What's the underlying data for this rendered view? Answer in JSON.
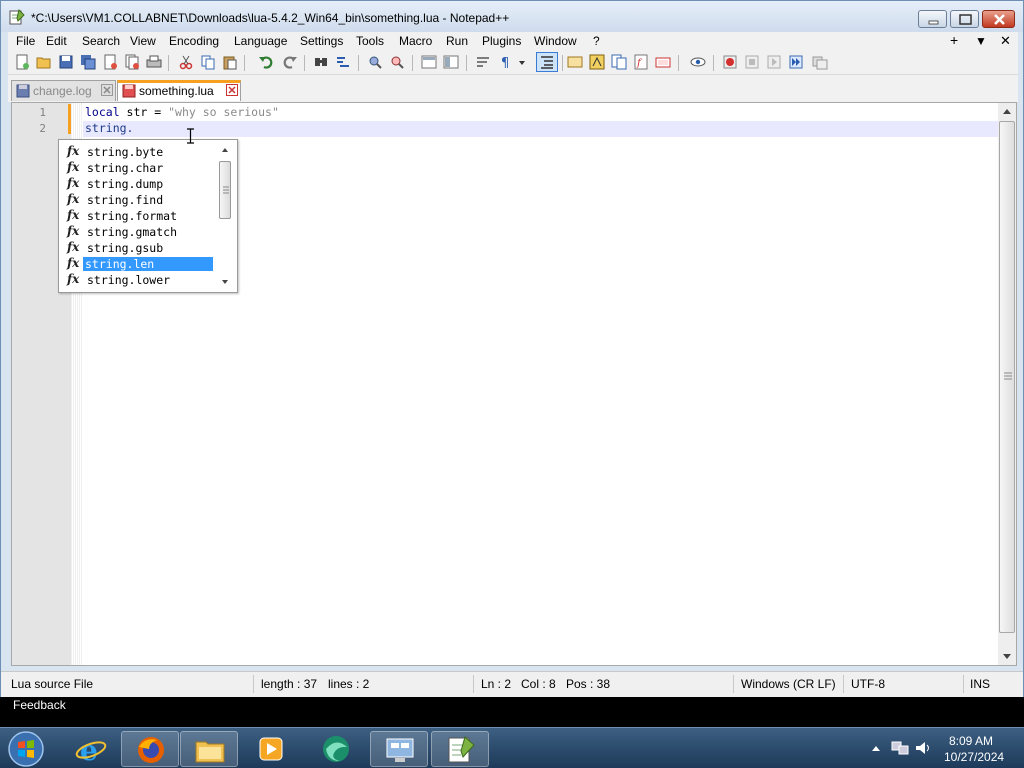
{
  "window": {
    "title": "*C:\\Users\\VM1.COLLABNET\\Downloads\\lua-5.4.2_Win64_bin\\something.lua - Notepad++"
  },
  "menu": [
    "File",
    "Edit",
    "Search",
    "View",
    "Encoding",
    "Language",
    "Settings",
    "Tools",
    "Macro",
    "Run",
    "Plugins",
    "Window",
    "?"
  ],
  "menu_right": {
    "add": "+",
    "dropdown": "▼",
    "close": "✕"
  },
  "tabs": [
    {
      "label": "change.log",
      "active": false
    },
    {
      "label": "something.lua",
      "active": true
    }
  ],
  "editor": {
    "line_numbers": [
      "1",
      "2"
    ],
    "line1": {
      "kw": "local",
      "mid": " str = ",
      "str": "\"why so serious\""
    },
    "line2": {
      "text": "string."
    }
  },
  "autocomplete": {
    "icon": "fx",
    "items": [
      "string.byte",
      "string.char",
      "string.dump",
      "string.find",
      "string.format",
      "string.gmatch",
      "string.gsub",
      "string.len",
      "string.lower"
    ],
    "selected": "string.len"
  },
  "statusbar": {
    "file_type": "Lua source File",
    "length": "length : 37",
    "lines": "lines : 2",
    "ln": "Ln : 2",
    "col": "Col : 8",
    "pos": "Pos : 38",
    "eol": "Windows (CR LF)",
    "encoding": "UTF-8",
    "mode": "INS"
  },
  "feedback": "Feedback",
  "taskbar": {
    "time": "8:09 AM",
    "date": "10/27/2024",
    "apps": [
      "internet-explorer",
      "firefox",
      "file-explorer",
      "media-player",
      "edge-like",
      "remote-desktop",
      "notepad-plus-plus"
    ]
  },
  "colors": {
    "accent_tab": "#f5a020",
    "selection": "#3399ff",
    "caret_line": "#e8e8ff"
  }
}
